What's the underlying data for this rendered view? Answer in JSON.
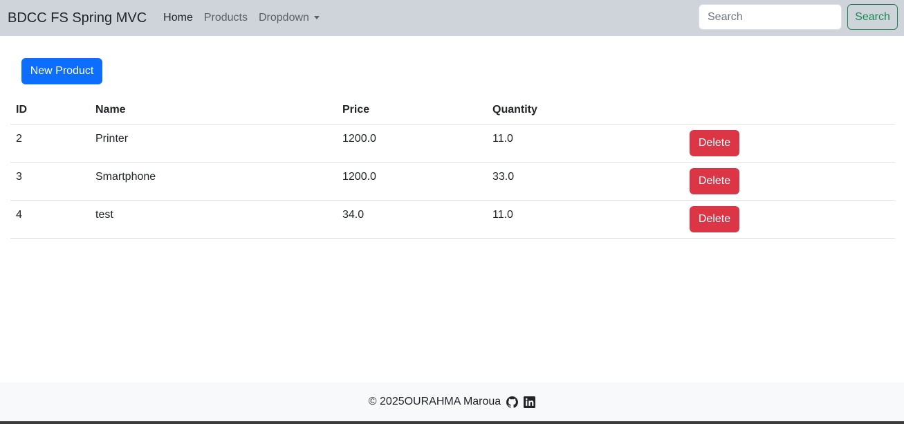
{
  "navbar": {
    "brand": "BDCC FS Spring MVC",
    "links": [
      {
        "label": "Home"
      },
      {
        "label": "Products"
      },
      {
        "label": "Dropdown"
      }
    ],
    "search": {
      "placeholder": "Search",
      "value": "",
      "button_label": "Search"
    }
  },
  "main": {
    "new_button_label": "New Product",
    "table": {
      "headers": [
        "ID",
        "Name",
        "Price",
        "Quantity"
      ],
      "rows": [
        {
          "id": "2",
          "name": "Printer",
          "price": "1200.0",
          "quantity": "11.0",
          "action": "Delete"
        },
        {
          "id": "3",
          "name": "Smartphone",
          "price": "1200.0",
          "quantity": "33.0",
          "action": "Delete"
        },
        {
          "id": "4",
          "name": "test",
          "price": "34.0",
          "quantity": "11.0",
          "action": "Delete"
        }
      ]
    }
  },
  "footer": {
    "text": "© 2025OURAHMA Maroua",
    "icons": [
      "github-icon",
      "linkedin-icon"
    ]
  },
  "colors": {
    "navbar_bg": "#cfd4da",
    "primary": "#0d6efd",
    "danger": "#dc3545",
    "success": "#198754",
    "footer_bg": "#f8f9fa"
  }
}
